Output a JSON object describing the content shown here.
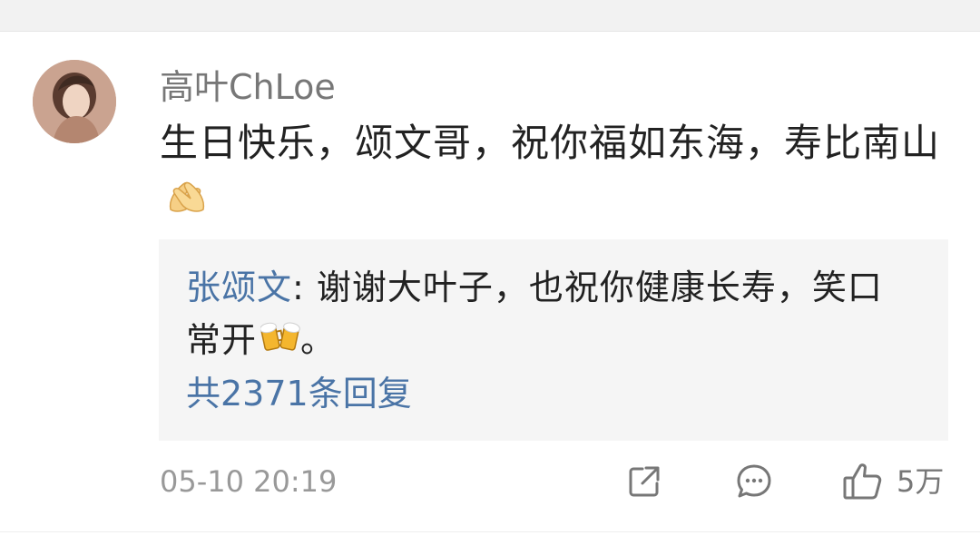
{
  "comment": {
    "username": "高叶ChLoe",
    "text": "生日快乐，颂文哥，祝你福如东海，寿比南山",
    "text_emoji": "pray-hands-icon",
    "reply": {
      "author": "张颂文",
      "separator": ": ",
      "text": "谢谢大叶子，也祝你健康长寿，笑口常开",
      "text_emoji": "beer-cheers-icon",
      "text_end": "。",
      "count_label": "共2371条回复"
    },
    "timestamp": "05-10 20:19",
    "like_count": "5万",
    "icons": [
      "share-icon",
      "comment-icon",
      "like-icon"
    ],
    "colors": {
      "link": "#4a74a6",
      "muted": "#777777",
      "reply_bg": "#f5f5f5"
    }
  }
}
